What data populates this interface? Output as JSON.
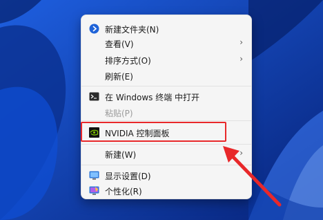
{
  "context_menu": {
    "items": [
      {
        "label": "新建文件夹(N)",
        "icon": "new-folder-icon"
      },
      {
        "label": "查看(V)",
        "has_submenu": true
      },
      {
        "label": "排序方式(O)",
        "has_submenu": true
      },
      {
        "label": "刷新(E)"
      },
      {
        "label": "在 Windows 终端 中打开",
        "icon": "terminal-icon"
      },
      {
        "label": "粘贴(P)",
        "disabled": true
      },
      {
        "label": "NVIDIA 控制面板",
        "icon": "nvidia-icon",
        "highlighted": true
      },
      {
        "label": "新建(W)",
        "has_submenu": true
      },
      {
        "label": "显示设置(D)",
        "icon": "display-settings-icon"
      },
      {
        "label": "个性化(R)",
        "icon": "personalize-icon"
      }
    ],
    "chevron_glyph": "›"
  },
  "colors": {
    "highlight_border": "#e8282a",
    "arrow": "#e8282a",
    "desktop_bg": "#0a3fae",
    "menu_bg": "#f5f5f5"
  }
}
